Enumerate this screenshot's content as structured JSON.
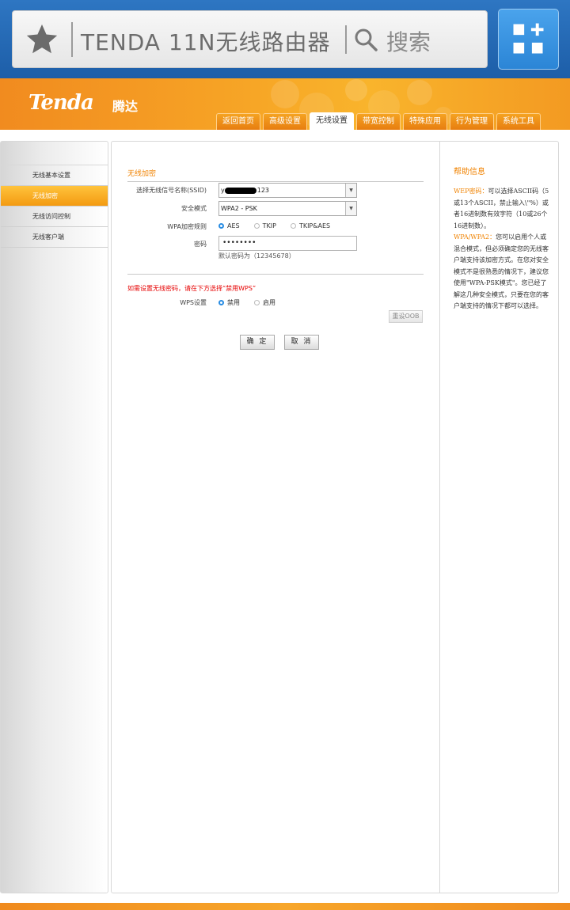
{
  "browser": {
    "url_text": "TENDA 11N无线路由器",
    "search_text": "搜索"
  },
  "brand": {
    "logo_text": "Tenda",
    "logo_cn": "腾达"
  },
  "tabs": [
    {
      "label": "返回首页",
      "active": false
    },
    {
      "label": "高级设置",
      "active": false
    },
    {
      "label": "无线设置",
      "active": true
    },
    {
      "label": "带宽控制",
      "active": false
    },
    {
      "label": "特殊应用",
      "active": false
    },
    {
      "label": "行为管理",
      "active": false
    },
    {
      "label": "系统工具",
      "active": false
    }
  ],
  "sidebar": {
    "items": [
      {
        "label": "无线基本设置",
        "active": false
      },
      {
        "label": "无线加密",
        "active": true
      },
      {
        "label": "无线访问控制",
        "active": false
      },
      {
        "label": "无线客户端",
        "active": false
      }
    ]
  },
  "form": {
    "section_title": "无线加密",
    "ssid_label": "选择无线信号名称(SSID)",
    "ssid_prefix": "y",
    "ssid_suffix": "123",
    "security_label": "安全模式",
    "security_value": "WPA2 - PSK",
    "wpa_rule_label": "WPA加密规则",
    "wpa_options": [
      {
        "label": "AES",
        "checked": true
      },
      {
        "label": "TKIP",
        "checked": false
      },
      {
        "label": "TKIP&AES",
        "checked": false
      }
    ],
    "password_label": "密码",
    "password_value": "••••••••",
    "password_hint": "默认密码为（12345678）",
    "wps_note": "如需设置无线密码，请在下方选择“禁用WPS”",
    "wps_label": "WPS设置",
    "wps_options": [
      {
        "label": "禁用",
        "checked": true
      },
      {
        "label": "启用",
        "checked": false
      }
    ],
    "oob_label": "重设OOB",
    "ok_label": "确 定",
    "cancel_label": "取 消"
  },
  "help": {
    "title": "帮助信息",
    "wep_key": "WEP密码：",
    "wep_text": "可以选择ASCII码（5或13个ASCII，禁止输入\\\"%）或者16进制数有效字符（10或26个16进制数）。",
    "wpa_key": "WPA/WPA2：",
    "wpa_text": "您可以启用个人或混合模式，但必须确定您的无线客户端支持该加密方式。在您对安全模式不是很熟悉的情况下，建议您使用\"WPA-PSK模式\"。您已经了解这几种安全模式，只要在您的客户端支持的情况下都可以选择。"
  },
  "colors": {
    "accent": "#f08200",
    "browser_blue": "#2e76c2",
    "warning_red": "#e60000",
    "radio_blue": "#2a8de3"
  },
  "icons": {
    "star": "star-icon",
    "search": "search-icon",
    "apps": "apps-grid-plus-icon"
  }
}
